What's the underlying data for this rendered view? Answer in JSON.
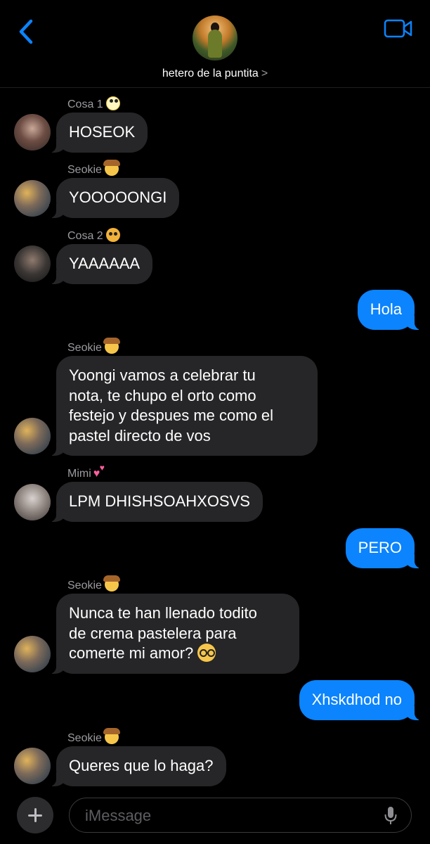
{
  "header": {
    "group_name": "hetero de la puntita",
    "chevron": ">",
    "back_icon": "chevron-left-icon",
    "video_icon": "video-camera-icon",
    "accent_color": "#0b84fe"
  },
  "messages": [
    {
      "type": "incoming",
      "sender": "Cosa 1",
      "sender_emoji": "face-with-rolling-eyes",
      "text": "HOSEOK"
    },
    {
      "type": "incoming",
      "sender": "Seokie",
      "sender_emoji": "cowboy-hat-face",
      "text": "YOOOOONGI"
    },
    {
      "type": "incoming",
      "sender": "Cosa 2",
      "sender_emoji": "angry-face",
      "text": "YAAAAAA"
    },
    {
      "type": "outgoing",
      "text": "Hola"
    },
    {
      "type": "incoming",
      "sender": "Seokie",
      "sender_emoji": "cowboy-hat-face",
      "lines": [
        "Yoongi vamos a celebrar tu",
        "nota, te chupo el orto como",
        "festejo y despues me como el",
        "pastel directo de vos"
      ]
    },
    {
      "type": "incoming",
      "sender": "Mimi",
      "sender_emoji": "two-hearts",
      "text": "LPM DHISHSOAHXOSVS"
    },
    {
      "type": "outgoing",
      "text": "PERO"
    },
    {
      "type": "incoming",
      "sender": "Seokie",
      "sender_emoji": "cowboy-hat-face",
      "lines": [
        "Nunca te han llenado todito",
        "de crema pastelera para",
        "comerte mi amor?"
      ],
      "trailing_emoji": "nerd-face"
    },
    {
      "type": "outgoing",
      "text": "Xhskdhod no"
    },
    {
      "type": "incoming",
      "sender": "Seokie",
      "sender_emoji": "cowboy-hat-face",
      "text": "Queres que lo haga?"
    }
  ],
  "composer": {
    "placeholder": "iMessage",
    "value": "",
    "plus_icon": "plus-icon",
    "mic_icon": "microphone-icon"
  },
  "colors": {
    "outgoing_bubble": "#0b84fe",
    "incoming_bubble": "#262628",
    "background": "#000000"
  }
}
